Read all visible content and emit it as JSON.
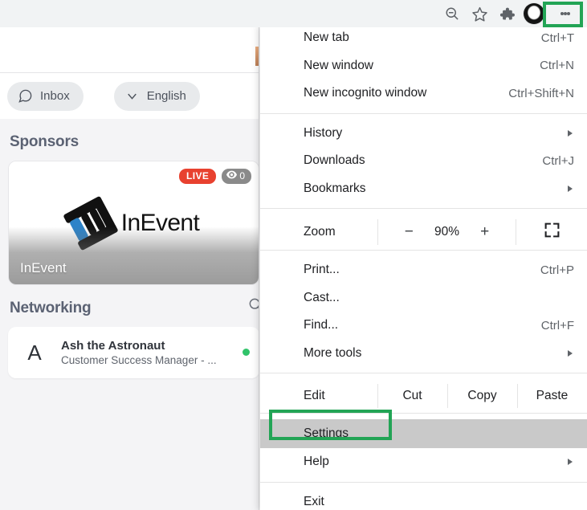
{
  "browser_toolbar": {
    "icons": [
      {
        "name": "zoom-out-icon",
        "glyph": "zoom-out"
      },
      {
        "name": "bookmark-star-icon",
        "glyph": "star"
      },
      {
        "name": "extensions-puzzle-icon",
        "glyph": "puzzle"
      },
      {
        "name": "profile-avatar-icon",
        "glyph": "avatar"
      }
    ],
    "menu_button_label": "Customize and control Google Chrome"
  },
  "highlights": {
    "accent_color": "#22a455",
    "menu_button_box_label": "three-dot-menu-highlight",
    "settings_box_label": "settings-item-highlight"
  },
  "webpage": {
    "toolbar": {
      "inbox_label": "Inbox",
      "language_label": "English"
    },
    "sponsors": {
      "section_title": "Sponsors",
      "card": {
        "live_badge": "LIVE",
        "views_count": "0",
        "logo_text": "InEvent",
        "name": "InEvent"
      }
    },
    "networking": {
      "section_title": "Networking",
      "people": [
        {
          "initial": "A",
          "name": "Ash the Astronaut",
          "role": "Customer Success Manager - ...",
          "status": "online"
        }
      ]
    }
  },
  "chrome_menu": {
    "groups": [
      {
        "items": [
          {
            "label": "New tab",
            "accel": "Ctrl+T",
            "submenu": false
          },
          {
            "label": "New window",
            "accel": "Ctrl+N",
            "submenu": false
          },
          {
            "label": "New incognito window",
            "accel": "Ctrl+Shift+N",
            "submenu": false
          }
        ]
      },
      {
        "items": [
          {
            "label": "History",
            "accel": "",
            "submenu": true
          },
          {
            "label": "Downloads",
            "accel": "Ctrl+J",
            "submenu": false
          },
          {
            "label": "Bookmarks",
            "accel": "",
            "submenu": true
          }
        ]
      }
    ],
    "zoom_row": {
      "label": "Zoom",
      "minus": "−",
      "value": "90%",
      "plus": "+",
      "fullscreen_name": "fullscreen-icon"
    },
    "tools_group": [
      {
        "label": "Print...",
        "accel": "Ctrl+P",
        "submenu": false
      },
      {
        "label": "Cast...",
        "accel": "",
        "submenu": false
      },
      {
        "label": "Find...",
        "accel": "Ctrl+F",
        "submenu": false
      },
      {
        "label": "More tools",
        "accel": "",
        "submenu": true
      }
    ],
    "edit_row": {
      "label": "Edit",
      "actions": [
        "Cut",
        "Copy",
        "Paste"
      ]
    },
    "bottom_group": [
      {
        "label": "Settings",
        "accel": "",
        "submenu": false,
        "highlighted": true
      },
      {
        "label": "Help",
        "accel": "",
        "submenu": true,
        "highlighted": false
      }
    ],
    "exit": {
      "label": "Exit",
      "accel": "",
      "submenu": false
    }
  }
}
